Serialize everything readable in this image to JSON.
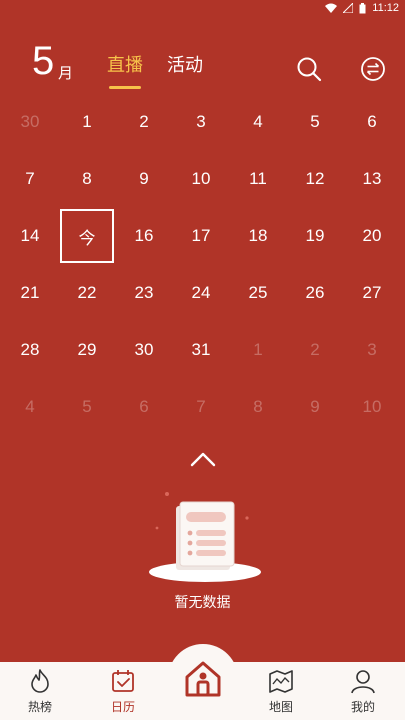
{
  "status_bar": {
    "time": "11:12"
  },
  "header": {
    "month_number": "5",
    "month_unit": "月",
    "tabs": [
      {
        "label": "直播",
        "active": true
      },
      {
        "label": "活动",
        "active": false
      }
    ],
    "icons": [
      "search-icon",
      "switch-icon"
    ]
  },
  "calendar": {
    "weeks": [
      [
        {
          "label": "30",
          "dim": true
        },
        {
          "label": "1"
        },
        {
          "label": "2"
        },
        {
          "label": "3"
        },
        {
          "label": "4"
        },
        {
          "label": "5"
        },
        {
          "label": "6"
        }
      ],
      [
        {
          "label": "7"
        },
        {
          "label": "8"
        },
        {
          "label": "9"
        },
        {
          "label": "10"
        },
        {
          "label": "11"
        },
        {
          "label": "12"
        },
        {
          "label": "13"
        }
      ],
      [
        {
          "label": "14"
        },
        {
          "label": "今",
          "today": true
        },
        {
          "label": "16"
        },
        {
          "label": "17"
        },
        {
          "label": "18"
        },
        {
          "label": "19"
        },
        {
          "label": "20"
        }
      ],
      [
        {
          "label": "21"
        },
        {
          "label": "22"
        },
        {
          "label": "23"
        },
        {
          "label": "24"
        },
        {
          "label": "25"
        },
        {
          "label": "26"
        },
        {
          "label": "27"
        }
      ],
      [
        {
          "label": "28"
        },
        {
          "label": "29"
        },
        {
          "label": "30"
        },
        {
          "label": "31"
        },
        {
          "label": "1",
          "dim": true
        },
        {
          "label": "2",
          "dim": true
        },
        {
          "label": "3",
          "dim": true
        }
      ],
      [
        {
          "label": "4",
          "dim": true
        },
        {
          "label": "5",
          "dim": true
        },
        {
          "label": "6",
          "dim": true
        },
        {
          "label": "7",
          "dim": true
        },
        {
          "label": "8",
          "dim": true
        },
        {
          "label": "9",
          "dim": true
        },
        {
          "label": "10",
          "dim": true
        }
      ]
    ]
  },
  "empty_state": {
    "text": "暂无数据"
  },
  "bottom_nav": {
    "items": [
      {
        "label": "热榜",
        "icon": "flame-icon",
        "active": false
      },
      {
        "label": "日历",
        "icon": "calendar-icon",
        "active": true
      },
      {
        "label": "地图",
        "icon": "map-icon",
        "active": false
      },
      {
        "label": "我的",
        "icon": "profile-icon",
        "active": false
      }
    ],
    "center_icon": "home-icon"
  },
  "colors": {
    "background": "#b03428",
    "accent": "#f7c34a",
    "nav_background": "#fbf7f4"
  }
}
